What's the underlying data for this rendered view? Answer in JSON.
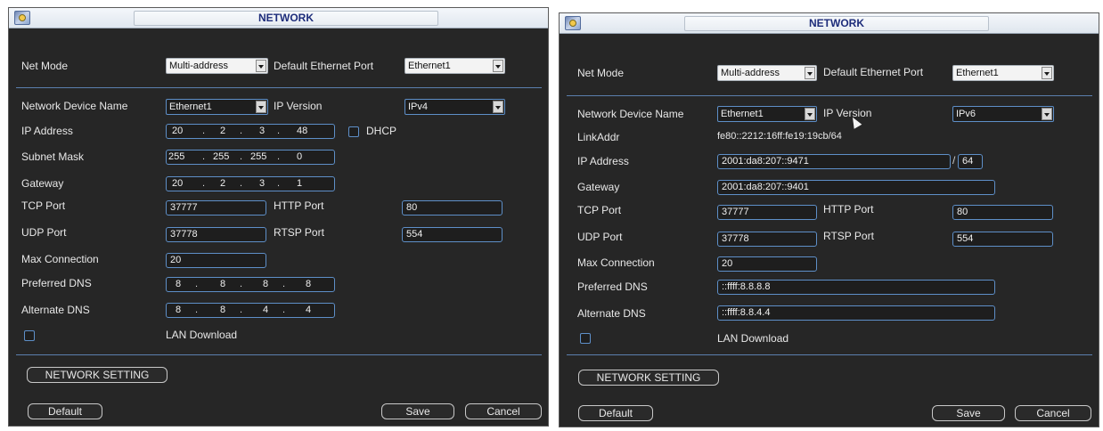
{
  "left": {
    "title": "NETWORK",
    "net_mode_label": "Net Mode",
    "net_mode_value": "Multi-address",
    "default_port_label": "Default Ethernet Port",
    "default_port_value": "Ethernet1",
    "device_name_label": "Network Device Name",
    "device_name_value": "Ethernet1",
    "ip_version_label": "IP Version",
    "ip_version_value": "IPv4",
    "ip_address_label": "IP Address",
    "ip_address": [
      "20",
      "2",
      "3",
      "48"
    ],
    "dhcp_label": "DHCP",
    "subnet_label": "Subnet Mask",
    "subnet": [
      "255",
      "255",
      "255",
      "0"
    ],
    "gateway_label": "Gateway",
    "gateway": [
      "20",
      "2",
      "3",
      "1"
    ],
    "tcp_label": "TCP Port",
    "tcp_value": "37777",
    "http_label": "HTTP Port",
    "http_value": "80",
    "udp_label": "UDP Port",
    "udp_value": "37778",
    "rtsp_label": "RTSP Port",
    "rtsp_value": "554",
    "maxconn_label": "Max Connection",
    "maxconn_value": "20",
    "pdns_label": "Preferred DNS",
    "pdns": [
      "8",
      "8",
      "8",
      "8"
    ],
    "adns_label": "Alternate DNS",
    "adns": [
      "8",
      "8",
      "4",
      "4"
    ],
    "lan_label": "LAN Download",
    "network_setting": "NETWORK SETTING",
    "default_btn": "Default",
    "save_btn": "Save",
    "cancel_btn": "Cancel"
  },
  "right": {
    "title": "NETWORK",
    "net_mode_label": "Net Mode",
    "net_mode_value": "Multi-address",
    "default_port_label": "Default Ethernet Port",
    "default_port_value": "Ethernet1",
    "device_name_label": "Network Device Name",
    "device_name_value": "Ethernet1",
    "ip_version_label": "IP Version",
    "ip_version_value": "IPv6",
    "linkaddr_label": "LinkAddr",
    "linkaddr_value": "fe80::2212:16ff:fe19:19cb/64",
    "ip_address_label": "IP Address",
    "ip_address_value": "2001:da8:207::9471",
    "prefix_value": "64",
    "gateway_label": "Gateway",
    "gateway_value": "2001:da8:207::9401",
    "tcp_label": "TCP Port",
    "tcp_value": "37777",
    "http_label": "HTTP Port",
    "http_value": "80",
    "udp_label": "UDP Port",
    "udp_value": "37778",
    "rtsp_label": "RTSP Port",
    "rtsp_value": "554",
    "maxconn_label": "Max Connection",
    "maxconn_value": "20",
    "pdns_label": "Preferred DNS",
    "pdns_value": "::ffff:8.8.8.8",
    "adns_label": "Alternate DNS",
    "adns_value": "::ffff:8.8.4.4",
    "lan_label": "LAN Download",
    "network_setting": "NETWORK SETTING",
    "default_btn": "Default",
    "save_btn": "Save",
    "cancel_btn": "Cancel"
  }
}
